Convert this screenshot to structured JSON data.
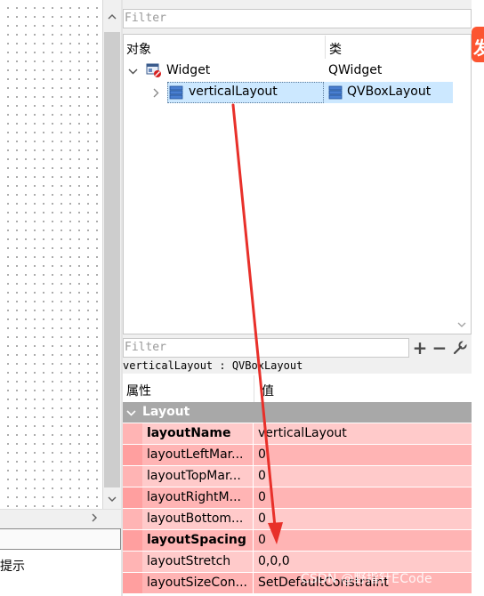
{
  "form_canvas": {
    "lower_hint": "提示"
  },
  "object_inspector": {
    "filter_placeholder": "Filter",
    "columns": {
      "object": "对象",
      "class": "类"
    },
    "rows": [
      {
        "name": "Widget",
        "class": "QWidget",
        "icon": "widget-icon",
        "expanded": true
      },
      {
        "name": "verticalLayout",
        "class": "QVBoxLayout",
        "icon": "vboxlayout-icon",
        "selected": true
      }
    ]
  },
  "property_editor": {
    "filter_placeholder": "Filter",
    "add_label": "+",
    "remove_label": "−",
    "object_class_label": "verticalLayout : QVBoxLayout",
    "columns": {
      "property": "属性",
      "value": "值"
    },
    "group": "Layout",
    "properties": [
      {
        "name": "layoutName",
        "value": "verticalLayout",
        "bold": true
      },
      {
        "name": "layoutLeftMar...",
        "value": "0",
        "bold": false
      },
      {
        "name": "layoutTopMar...",
        "value": "0",
        "bold": false
      },
      {
        "name": "layoutRightM...",
        "value": "0",
        "bold": false
      },
      {
        "name": "layoutBottom...",
        "value": "0",
        "bold": false
      },
      {
        "name": "layoutSpacing",
        "value": "0",
        "bold": true
      },
      {
        "name": "layoutStretch",
        "value": "0,0,0",
        "bold": false
      },
      {
        "name": "layoutSizeCon...",
        "value": "SetDefaultConstraint",
        "bold": false
      }
    ]
  },
  "side_badge": {
    "text": "发",
    "color": "#fc5531"
  },
  "annotation": {
    "color": "#e8302a"
  },
  "watermark": "CSDN @野指针ECode",
  "colors": {
    "selection": "#cce8ff",
    "group_header": "#a8a8a8",
    "row_light": "#ffcaca",
    "row_dark": "#ffb4b4"
  }
}
